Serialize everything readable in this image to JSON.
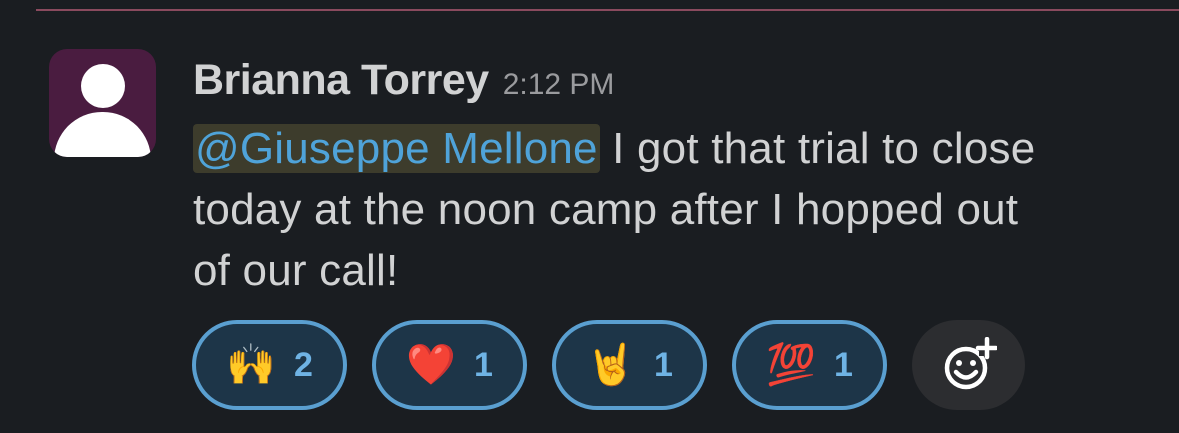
{
  "message": {
    "author": "Brianna Torrey",
    "time": "2:12 PM",
    "mention": "@Giuseppe Mellone",
    "text": " I got that trial to close today at the noon camp after I hopped out of our call!"
  },
  "reactions": [
    {
      "emoji": "🙌",
      "icon": "raising-hands-icon",
      "count": "2"
    },
    {
      "emoji": "❤️",
      "icon": "red-heart-icon",
      "count": "1"
    },
    {
      "emoji": "🤘",
      "icon": "sign-of-horns-icon",
      "count": "1"
    },
    {
      "emoji": "💯",
      "icon": "hundred-points-icon",
      "count": "1"
    }
  ],
  "colors": {
    "background": "#1a1d21",
    "avatar": "#4a1c40",
    "mention_text": "#4fa3d9",
    "mention_highlight": "#3d3c2c",
    "reaction_border": "#5a9fd0",
    "reaction_fill": "#1d3548",
    "divider": "#8a4a5e"
  },
  "icons": {
    "add_reaction": "add-reaction-icon",
    "avatar": "default-user-avatar"
  }
}
